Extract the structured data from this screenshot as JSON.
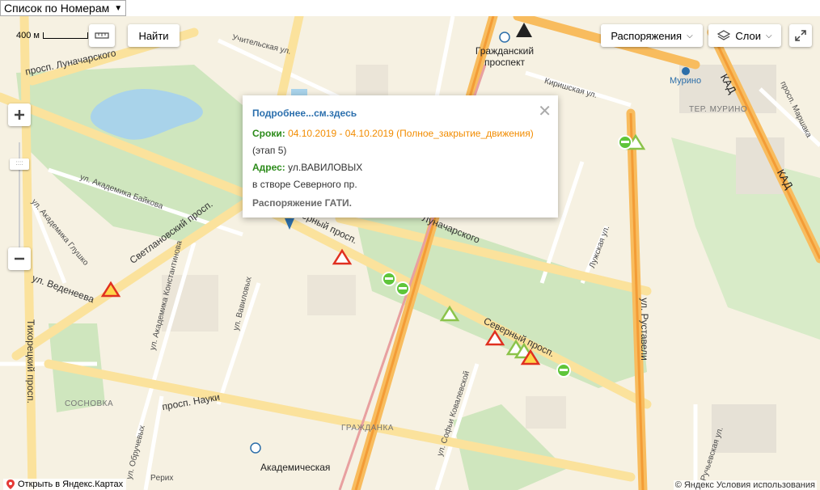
{
  "select": {
    "value": "Список по Номерам"
  },
  "map": {
    "scale": "400 м",
    "controls": {
      "find": "Найти",
      "orders": "Распоряжения",
      "layers": "Слои"
    },
    "popup": {
      "link": "Подробнее...см.здесь",
      "period_label": "Сроки:",
      "period_value": "04.10.2019 - 04.10.2019 (Полное_закрытие_движения)",
      "stage": "(этап 5)",
      "address_label": "Адрес:",
      "address_value": "ул.ВАВИЛОВЫХ",
      "address_detail": "в створе Северного пр.",
      "order": "Распоряжение ГАТИ."
    },
    "labels": {
      "severny": "Северный просп.",
      "svetlanovsky": "Светлановский просп.",
      "nauki": "просп. Науки",
      "veteneeva": "ул. Веденеева",
      "rustaveli": "ул. Руставели",
      "lunacharskogo_top": "просп. Луначарского",
      "lunacharskogo_mid": "Луначарского",
      "tikhoretsky": "Тихорецкий просп.",
      "kad_top": "КАД",
      "kad_bottom": "КАД",
      "grazhdansky": "Гражданский проспект",
      "murino": "Мурино",
      "ter_murino": "ТЕР. МУРИНО",
      "akademicheskaya": "Академическая",
      "sosnovka": "СОСНОВКА",
      "grazhdanka": "ГРАЖДАНКА",
      "uchitelskaya": "Учительская ул.",
      "kirishskaya": "Киришская ул.",
      "akademika_baykova": "ул. Академика Байкова",
      "akademika_glushko": "ул. Академика Глушко",
      "akademika_konstantinova": "ул. Академика Константинова",
      "vavilovykh": "ул. Вавиловых",
      "sofi_kovalevskoy": "ул. Софьи Ковалевской",
      "luzhskaya": "Лужская ул.",
      "marshaka": "просп. Маршака",
      "obruchevykh": "ул. Обручевых",
      "ruchyevskaya": "Ручьевская ул.",
      "perekhod": "Pерих"
    },
    "footer": {
      "open_link": "Открыть в Яндекс.Картах",
      "copyright": "© Яндекс  Условия использования"
    }
  }
}
